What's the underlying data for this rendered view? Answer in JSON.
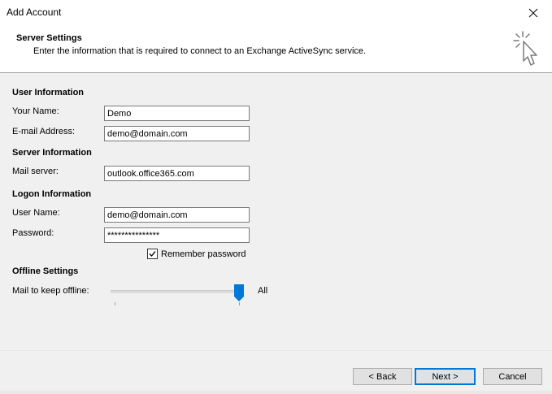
{
  "window": {
    "title": "Add Account"
  },
  "header": {
    "title": "Server Settings",
    "subtitle": "Enter the information that is required to connect to an Exchange ActiveSync service."
  },
  "user_information": {
    "heading": "User Information",
    "your_name_label": "Your Name:",
    "your_name_value": "Demo",
    "email_label": "E-mail Address:",
    "email_value": "demo@domain.com"
  },
  "server_information": {
    "heading": "Server Information",
    "mail_server_label": "Mail server:",
    "mail_server_value": "outlook.office365.com"
  },
  "logon_information": {
    "heading": "Logon Information",
    "user_name_label": "User Name:",
    "user_name_value": "demo@domain.com",
    "password_label": "Password:",
    "password_value": "***************",
    "remember_password_label": "Remember password",
    "remember_password_checked": true
  },
  "offline_settings": {
    "heading": "Offline Settings",
    "mail_to_keep_label": "Mail to keep offline:",
    "slider_value_label": "All",
    "slider_fraction": 1.0
  },
  "buttons": {
    "back": "< Back",
    "next": "Next >",
    "cancel": "Cancel"
  },
  "colors": {
    "accent": "#0078d7",
    "content_background": "#f0f0f0"
  },
  "icons": {
    "close": "close-icon",
    "wizard": "cursor-click-icon",
    "checkbox": "checkmark-icon"
  }
}
